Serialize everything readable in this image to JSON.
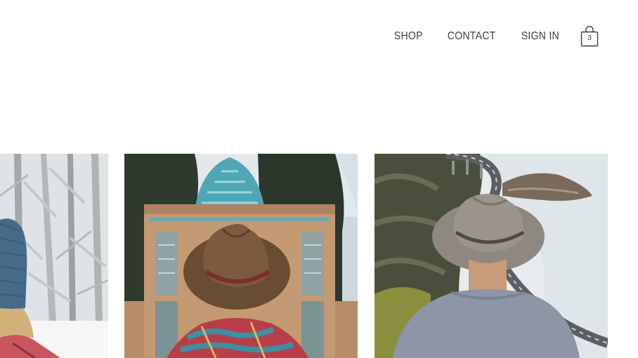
{
  "nav": {
    "shop_label": "SHOP",
    "contact_label": "CONTACT",
    "signin_label": "SIGN IN",
    "cart_count": "3"
  },
  "gallery": {
    "photos": [
      {
        "subject": "person in blue knit beanie in snowy forest"
      },
      {
        "subject": "person in brown hat facing tiled mosque gate"
      },
      {
        "subject": "person in grey hat overlooking coastal bridge road"
      }
    ]
  },
  "colors": {
    "nav_text": "#3f3f3f",
    "background": "#ffffff"
  }
}
